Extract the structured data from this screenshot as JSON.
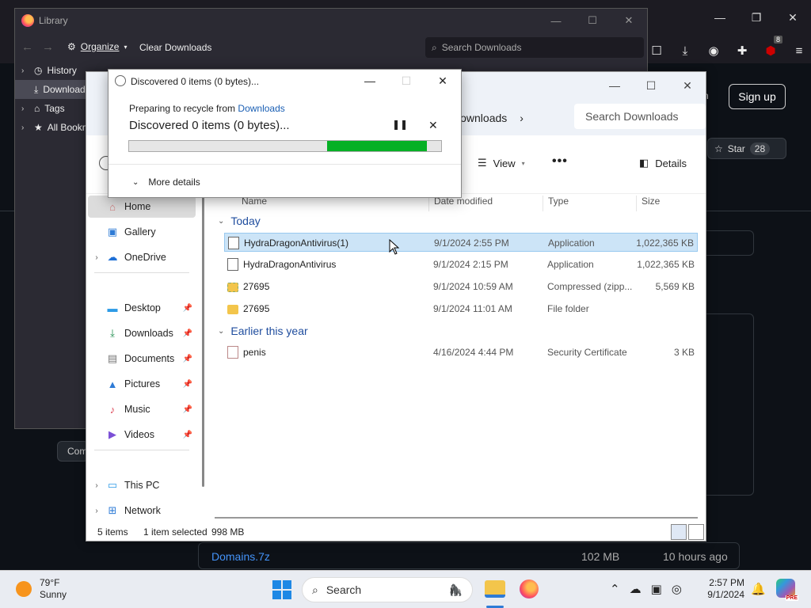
{
  "firefox": {
    "toolbar_badge": "8",
    "signup_label": "Sign up",
    "topbar_fragment": "n",
    "star_label": "Star",
    "star_count": "28",
    "comment_fragment": "Com",
    "release_file": "Domains.7z",
    "release_size": "102 MB",
    "release_time": "10 hours ago"
  },
  "library": {
    "title": "Library",
    "organize_label": "Organize",
    "clear_label": "Clear Downloads",
    "search_placeholder": "Search Downloads",
    "sidebar": [
      {
        "label": "History",
        "icon": "clock-icon"
      },
      {
        "label": "Downloads",
        "icon": "download-icon"
      },
      {
        "label": "Tags",
        "icon": "tag-icon"
      },
      {
        "label": "All Bookmarks",
        "icon": "star-icon"
      }
    ]
  },
  "explorer": {
    "breadcrumb": "Downloads",
    "search_placeholder": "Search Downloads",
    "view_label": "View",
    "details_label": "Details",
    "nav": {
      "home": "Home",
      "gallery": "Gallery",
      "onedrive": "OneDrive",
      "desktop": "Desktop",
      "downloads": "Downloads",
      "documents": "Documents",
      "pictures": "Pictures",
      "music": "Music",
      "videos": "Videos",
      "thispc": "This PC",
      "network": "Network"
    },
    "columns": {
      "name": "Name",
      "date": "Date modified",
      "type": "Type",
      "size": "Size"
    },
    "groups": {
      "today": "Today",
      "earlier": "Earlier this year"
    },
    "rows": [
      {
        "name": "HydraDragonAntivirus(1)",
        "date": "9/1/2024 2:55 PM",
        "type": "Application",
        "size": "1,022,365 KB",
        "icon": "file-icon"
      },
      {
        "name": "HydraDragonAntivirus",
        "date": "9/1/2024 2:15 PM",
        "type": "Application",
        "size": "1,022,365 KB",
        "icon": "file-icon"
      },
      {
        "name": "27695",
        "date": "9/1/2024 10:59 AM",
        "type": "Compressed (zipp...",
        "size": "5,569 KB",
        "icon": "zip-folder-icon"
      },
      {
        "name": "27695",
        "date": "9/1/2024 11:01 AM",
        "type": "File folder",
        "size": "",
        "icon": "folder-icon"
      },
      {
        "name": "penis",
        "date": "4/16/2024 4:44 PM",
        "type": "Security Certificate",
        "size": "3 KB",
        "icon": "certificate-icon"
      }
    ],
    "status": {
      "count": "5 items",
      "selected": "1 item selected",
      "selected_size": "998 MB"
    }
  },
  "dialog": {
    "title": "Discovered 0 items (0 bytes)...",
    "from_prefix": "Preparing to recycle from",
    "from_link": "Downloads",
    "status": "Discovered 0 items (0 bytes)...",
    "more_details": "More details",
    "progress_start": 0.635,
    "progress_end": 0.955
  },
  "taskbar": {
    "temp": "79°F",
    "condition": "Sunny",
    "search_placeholder": "Search",
    "time": "2:57 PM",
    "date": "9/1/2024",
    "copilot_badge": "PRE"
  },
  "colors": {
    "progress_green": "#06b025",
    "selection_blue": "#cce4f7",
    "group_blue": "#1f4d9e",
    "link_blue": "#1a5fb4",
    "github_cyan": "#00b4e6"
  }
}
